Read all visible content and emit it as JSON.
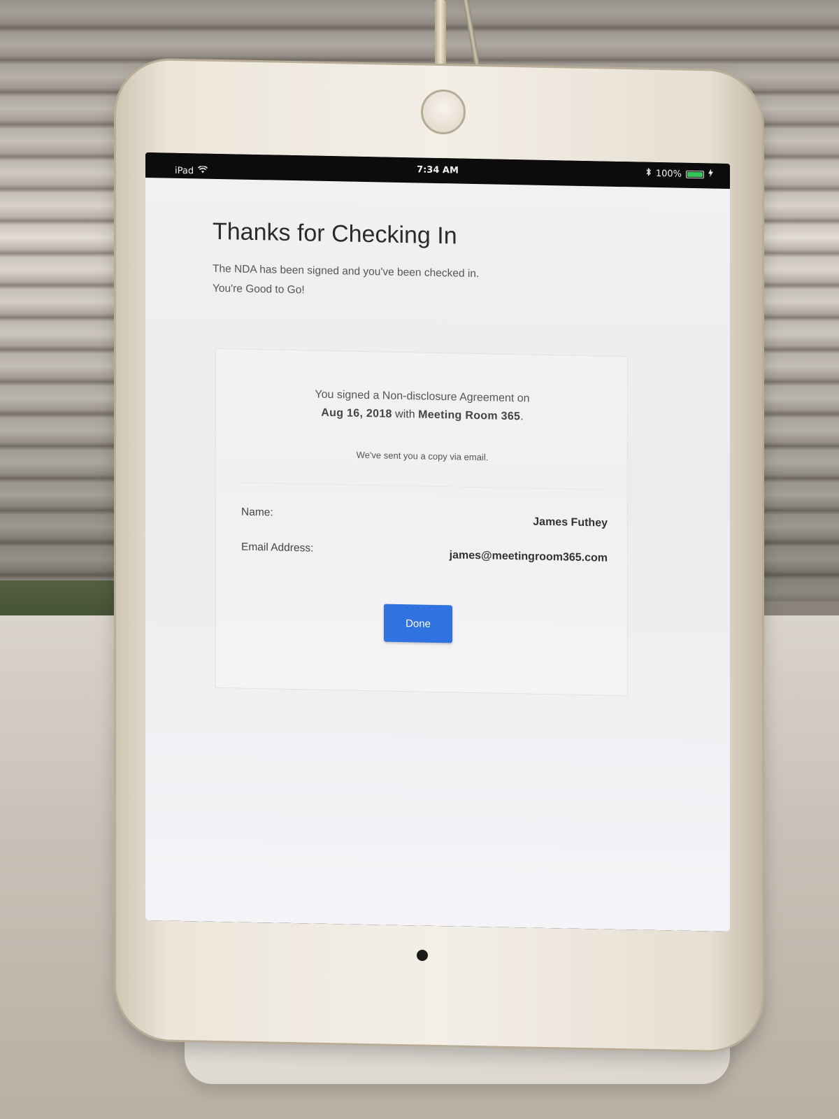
{
  "status_bar": {
    "device": "iPad",
    "time": "7:34 AM",
    "battery": "100%",
    "battery_level": 1.0
  },
  "page": {
    "title": "Thanks for Checking In",
    "subtitle_line1": "The NDA has been signed and you've been checked in.",
    "subtitle_line2": "You're Good to Go!"
  },
  "card": {
    "line1": "You signed a Non-disclosure Agreement on",
    "date": "Aug 16, 2018",
    "with_word": " with ",
    "company": "Meeting Room 365",
    "period": ".",
    "email_note": "We've sent you a copy via email.",
    "name_label": "Name:",
    "name_value": "James Futhey",
    "email_label": "Email Address:",
    "email_value": "james@meetingroom365.com",
    "done_label": "Done"
  },
  "colors": {
    "accent": "#2f72e0",
    "battery": "#35c759"
  },
  "icons": [
    "wifi-icon",
    "bluetooth-icon",
    "battery-icon",
    "charging-bolt-icon"
  ]
}
